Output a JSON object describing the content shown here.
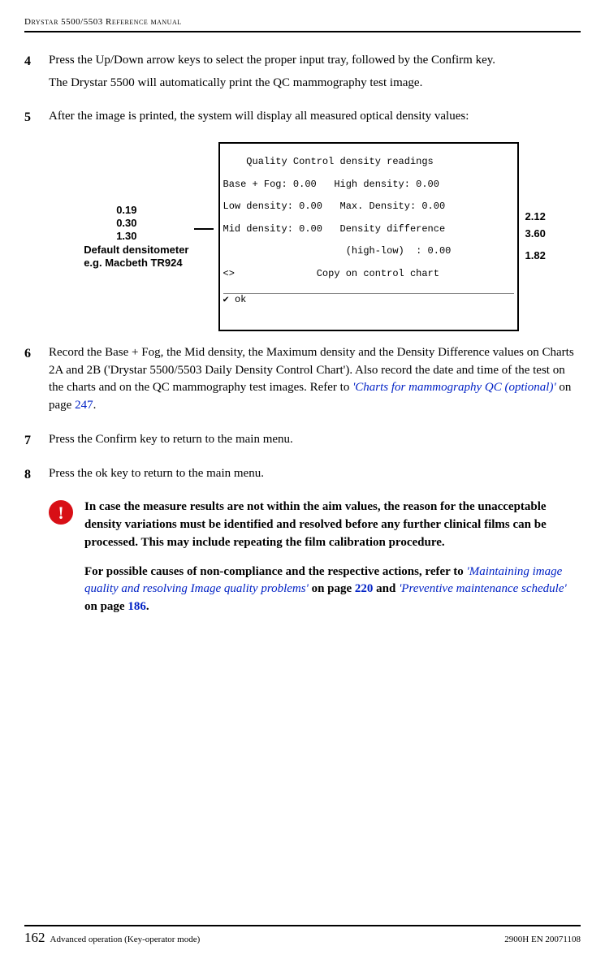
{
  "header": {
    "title": "Drystar 5500/5503 Reference manual"
  },
  "steps": {
    "s4": {
      "num": "4",
      "text": "Press the Up/Down arrow keys to select the proper input tray, followed by the Confirm key.",
      "sub": "The Drystar 5500 will automatically print the QC mammography test image."
    },
    "s5": {
      "num": "5",
      "text": "After the image is printed, the system will display all measured optical density values:"
    },
    "s6": {
      "num": "6",
      "text_a": "Record the Base + Fog, the Mid density, the Maximum density and the Density Difference values on Charts 2A and 2B ('Drystar 5500/5503 Daily Density Control Chart'). Also record the date and time of the test on the charts and on the QC mammography test images. Refer to ",
      "link1": "'Charts for mammography QC (optional)'",
      "text_b": " on page ",
      "page1": "247",
      "text_c": "."
    },
    "s7": {
      "num": "7",
      "text": "Press the Confirm key to return to the main menu."
    },
    "s8": {
      "num": "8",
      "text": "Press the ok key to return to the main menu."
    }
  },
  "lcd": {
    "title": "    Quality Control density readings",
    "l1": "Base + Fog: 0.00   High density: 0.00",
    "l2": "Low density: 0.00   Max. Density: 0.00",
    "l3": "Mid density: 0.00   Density difference",
    "l4": "                     (high-low)  : 0.00",
    "l5": "<>              Copy on control chart",
    "ok_label": "ok"
  },
  "annot": {
    "left_n1": "0.19",
    "left_n2": "0.30",
    "left_n3": "1.30",
    "left_lbl1": "Default densitometer",
    "left_lbl2": "e.g. Macbeth TR924",
    "right_n1": "2.12",
    "right_n2": "3.60",
    "right_n3": "1.82"
  },
  "warning": {
    "icon": "!",
    "p1": "In case the measure results are not within the aim values, the reason for the unacceptable density variations must be identified and resolved before any further clinical films can be processed. This may include repeating the film calibration procedure.",
    "p2a": "For possible causes of non-compliance and the respective actions, refer to ",
    "link1": "'Maintaining image quality and resolving Image quality problems'",
    "p2b": " on page ",
    "page1": "220",
    "p2c": " and ",
    "link2": "'Preventive maintenance schedule'",
    "p2d": " on page ",
    "page2": "186",
    "p2e": "."
  },
  "footer": {
    "page": "162",
    "left": "Advanced operation (Key-operator mode)",
    "right": "2900H EN 20071108"
  }
}
